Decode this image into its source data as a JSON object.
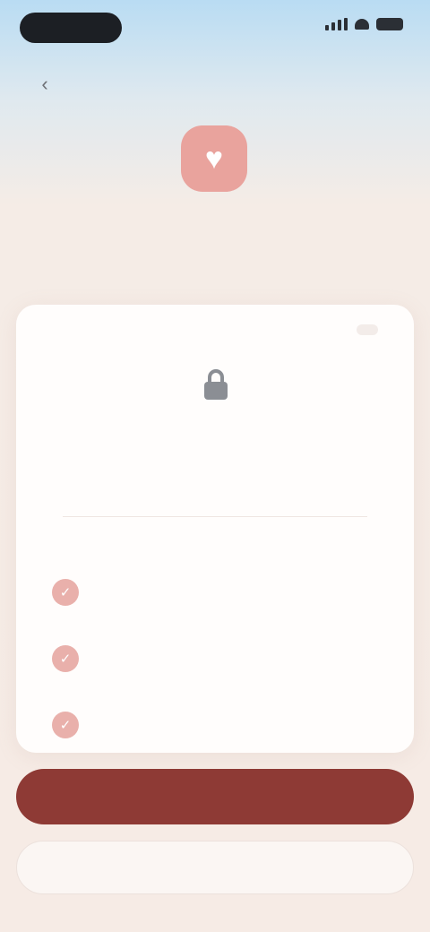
{
  "status_bar": {
    "time": ""
  },
  "nav": {
    "back_icon": "chevron-left-icon",
    "top_link": ""
  },
  "hero": {
    "icon": "heart-icon",
    "title": "",
    "subtitle": ""
  },
  "card": {
    "badge": "",
    "icon": "lock-icon",
    "heading": "",
    "description": "",
    "features": [
      {
        "icon": "check-icon",
        "text": ""
      },
      {
        "icon": "check-icon",
        "text": ""
      },
      {
        "icon": "check-icon",
        "text": ""
      }
    ]
  },
  "actions": {
    "primary_label": "",
    "primary_secondary_label": "",
    "secondary_label": ""
  },
  "colors": {
    "accent": "#8e3a35",
    "hero_icon": "#e9a39d",
    "feature_icon": "#e9b0ab",
    "card_bg": "#fffdfc",
    "background": "#f6ebe5"
  }
}
